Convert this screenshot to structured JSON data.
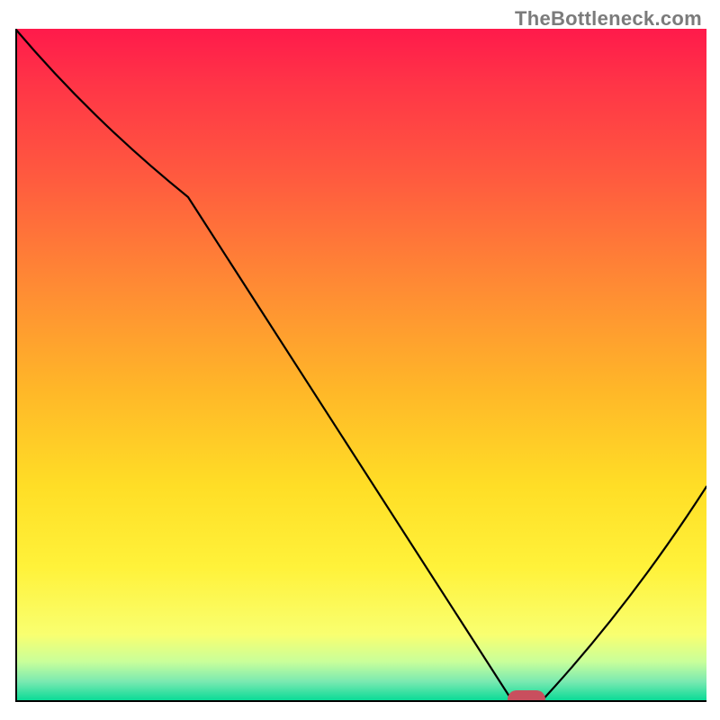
{
  "watermark": "TheBottleneck.com",
  "chart_data": {
    "type": "line",
    "title": "",
    "xlabel": "",
    "ylabel": "",
    "xlim": [
      0,
      100
    ],
    "ylim": [
      0,
      100
    ],
    "x": [
      0,
      25,
      72,
      76,
      100
    ],
    "values": [
      100,
      75,
      0,
      0,
      32
    ],
    "marker": {
      "x": 74,
      "y": 0,
      "color": "#c94f5e"
    },
    "gradient_colors_top_to_bottom": [
      "#ff1a4b",
      "#ff8a34",
      "#ffde26",
      "#f9ff70",
      "#00d994"
    ],
    "note": "Background vertical gradient from red (top) through orange, yellow, to green (bottom). Black curve descends from upper-left, kinks near x≈25, dives to the floor around x≈72–76 where a red pill marker sits, then rises toward x=100."
  }
}
